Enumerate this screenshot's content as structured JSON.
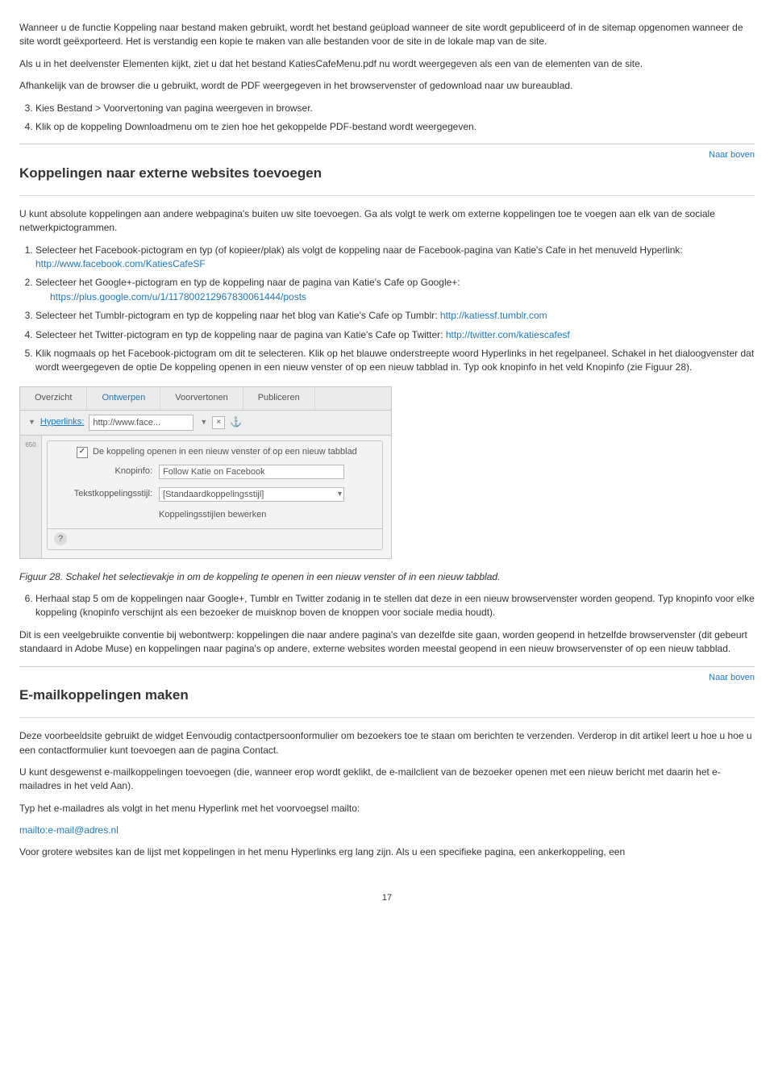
{
  "intro": {
    "p1": "Wanneer u de functie Koppeling naar bestand maken gebruikt, wordt het bestand geüpload wanneer de site wordt gepubliceerd of in de sitemap opgenomen wanneer de site wordt geëxporteerd. Het is verstandig een kopie te maken van alle bestanden voor de site in de lokale map van de site.",
    "p2": "Als u in het deelvenster Elementen kijkt, ziet u dat het bestand KatiesCafeMenu.pdf nu wordt weergegeven als een van de elementen van de site.",
    "p3": "Afhankelijk van de browser die u gebruikt, wordt de PDF weergegeven in het browservenster of gedownload naar uw bureaublad.",
    "step3": "Kies Bestand > Voorvertoning van pagina weergeven in browser.",
    "step4": "Klik op de koppeling Downloadmenu om te zien hoe het gekoppelde PDF-bestand wordt weergegeven."
  },
  "toTop": "Naar boven",
  "sectionA": {
    "title": "Koppelingen naar externe websites toevoegen",
    "intro": "U kunt absolute koppelingen aan andere webpagina's buiten uw site toevoegen. Ga als volgt te werk om externe koppelingen toe te voegen aan elk van de sociale netwerkpictogrammen.",
    "li1a": "Selecteer het Facebook-pictogram en typ (of kopieer/plak) als volgt de koppeling naar de Facebook-pagina van Katie's Cafe in het menuveld Hyperlink: ",
    "li1link": "http://www.facebook.com/KatiesCafeSF",
    "li2": "Selecteer het Google+-pictogram en typ de koppeling naar de pagina van Katie's Cafe op Google+:",
    "li2link": "https://plus.google.com/u/1/117800212967830061444/posts",
    "li3a": "Selecteer het Tumblr-pictogram en typ de koppeling naar het blog van Katie's Cafe op Tumblr: ",
    "li3link": "http://katiessf.tumblr.com",
    "li4a": "Selecteer het Twitter-pictogram en typ de koppeling naar de pagina van Katie's Cafe op Twitter: ",
    "li4link": "http://twitter.com/katiescafesf",
    "li5": "Klik nogmaals op het Facebook-pictogram om dit te selecteren. Klik op het blauwe onderstreepte woord Hyperlinks in het regelpaneel. Schakel in het dialoogvenster dat wordt weergegeven de optie De koppeling openen in een nieuw venster of op een nieuw tabblad in. Typ ook knopinfo in het veld Knopinfo (zie Figuur 28).",
    "caption": "Figuur 28. Schakel het selectievakje in om de koppeling te openen in een nieuw venster of in een nieuw tabblad.",
    "li6": "Herhaal stap 5 om de koppelingen naar Google+, Tumblr en Twitter zodanig in te stellen dat deze in een nieuw browservenster worden geopend. Typ knopinfo voor elke koppeling (knopinfo verschijnt als een bezoeker de muisknop boven de knoppen voor sociale media houdt).",
    "outro": "Dit is een veelgebruikte conventie bij webontwerp: koppelingen die naar andere pagina's van dezelfde site gaan, worden geopend in hetzelfde browservenster (dit gebeurt standaard in Adobe Muse) en koppelingen naar pagina's op andere, externe websites worden meestal geopend in een nieuw browservenster of op een nieuw tabblad."
  },
  "sectionB": {
    "title": "E-mailkoppelingen maken",
    "p1": "Deze voorbeeldsite gebruikt de widget Eenvoudig contactpersoonformulier om bezoekers toe te staan om berichten te verzenden. Verderop in dit artikel leert u hoe u hoe u een contactformulier kunt toevoegen aan de pagina Contact.",
    "p2": "U kunt desgewenst e-mailkoppelingen toevoegen (die, wanneer erop wordt geklikt, de e-mailclient van de bezoeker openen met een nieuw bericht met daarin het e-mailadres in het veld Aan).",
    "p3": "Typ het e-mailadres als volgt in het menu Hyperlink met het voorvoegsel mailto:",
    "mail": "mailto:e-mail@adres.nl",
    "p4": "Voor grotere websites kan de lijst met koppelingen in het menu Hyperlinks erg lang zijn. Als u een specifieke pagina, een ankerkoppeling, een"
  },
  "figure": {
    "tabs": {
      "overview": "Overzicht",
      "design": "Ontwerpen",
      "preview": "Voorvertonen",
      "publish": "Publiceren"
    },
    "hyperlinksLabel": "Hyperlinks:",
    "hyperlinksValue": "http://www.face...",
    "ruler": "650",
    "checkbox": "De koppeling openen in een nieuw venster of op een nieuw tabblad",
    "knopinfoLabel": "Knopinfo:",
    "knopinfoValue": "Follow Katie on Facebook",
    "styleLabel": "Tekstkoppelingsstijl:",
    "styleValue": "[Standaardkoppelingsstijl]",
    "editStyles": "Koppelingsstijlen bewerken"
  },
  "pageNumber": "17"
}
